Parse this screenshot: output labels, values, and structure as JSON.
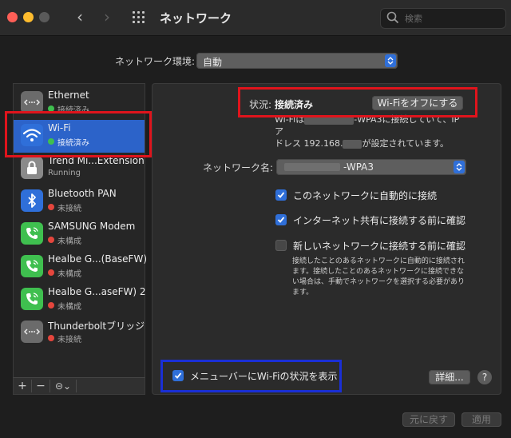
{
  "window": {
    "title": "ネットワーク"
  },
  "search": {
    "placeholder": "検索"
  },
  "location": {
    "label": "ネットワーク環境:",
    "value": "自動"
  },
  "sidebar": {
    "items": [
      {
        "name": "Ethernet",
        "status": "接続済み",
        "dot_color": "#3fbf4f",
        "icon": "ethernet-icon",
        "icon_color": "#6b6b6b"
      },
      {
        "name": "Wi-Fi",
        "status": "接続済み",
        "dot_color": "#3fbf4f",
        "icon": "wifi-icon",
        "icon_color": "#2f6fd9",
        "selected": true
      },
      {
        "name": "Trend Mi...Extension",
        "status": "Running",
        "dot_color": "",
        "icon": "lock-icon",
        "icon_color": "#8a8a8a"
      },
      {
        "name": "Bluetooth PAN",
        "status": "未接続",
        "dot_color": "#e5463d",
        "icon": "bluetooth-icon",
        "icon_color": "#2f6fd9"
      },
      {
        "name": "SAMSUNG Modem",
        "status": "未構成",
        "dot_color": "#e5463d",
        "icon": "phone-icon",
        "icon_color": "#3fbf4f"
      },
      {
        "name": "Healbe G...(BaseFW)",
        "status": "未構成",
        "dot_color": "#e5463d",
        "icon": "phone-icon",
        "icon_color": "#3fbf4f"
      },
      {
        "name": "Healbe G...aseFW) 2",
        "status": "未構成",
        "dot_color": "#e5463d",
        "icon": "phone-icon",
        "icon_color": "#3fbf4f"
      },
      {
        "name": "Thunderboltブリッジ",
        "status": "未接続",
        "dot_color": "#e5463d",
        "icon": "ethernet-icon",
        "icon_color": "#6b6b6b"
      }
    ],
    "footer": {
      "add": "+",
      "remove": "−",
      "action": "⊝⌄"
    }
  },
  "detail": {
    "status_label": "状況:",
    "status_value": "接続済み",
    "wifi_off_button": "Wi-Fiをオフにする",
    "desc_line1_a": "Wi-Fiは",
    "desc_line1_b": "-WPA3に接続していて、IPア",
    "desc_line2_a": "ドレス 192.168.",
    "desc_line2_b": "が設定されています。",
    "network_name_label": "ネットワーク名:",
    "network_name_value": "-WPA3",
    "auto_join_label": "このネットワークに自動的に接続",
    "auto_join_checked": true,
    "ask_hotspot_label": "インターネット共有に接続する前に確認",
    "ask_hotspot_checked": true,
    "ask_new_label": "新しいネットワークに接続する前に確認",
    "ask_new_checked": false,
    "note": "接続したことのあるネットワークに自動的に接続されます。接続したことのあるネットワークに接続できない場合は、手動でネットワークを選択する必要があります。",
    "menubar_label": "メニューバーにWi-Fiの状況を表示",
    "menubar_checked": true,
    "advanced_button": "詳細...",
    "help_button": "?"
  },
  "bottom": {
    "revert_button": "元に戻す",
    "apply_button": "適用"
  },
  "highlights": {
    "red": "#e0141c",
    "blue": "#1a2fd6"
  }
}
